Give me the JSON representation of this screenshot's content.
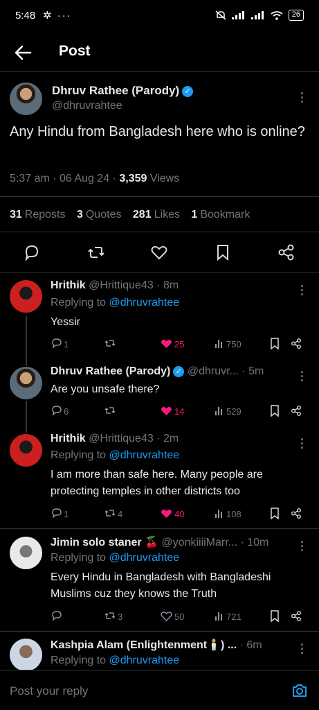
{
  "status_bar": {
    "time": "5:48",
    "left_icons": "✲ ···",
    "battery": "26"
  },
  "header": {
    "title": "Post"
  },
  "post": {
    "author_name": "Dhruv Rathee (Parody)",
    "author_handle": "@dhruvrahtee",
    "verified_mark": "✓",
    "text": "Any Hindu from Bangladesh here who is online?",
    "time_date": "5:37 am · 06 Aug 24 · ",
    "views_count": "3,359",
    "views_label": " Views",
    "reposts_count": "31",
    "reposts_label": "Reposts",
    "quotes_count": "3",
    "quotes_label": "Quotes",
    "likes_count": "281",
    "likes_label": "Likes",
    "bookmarks_count": "1",
    "bookmarks_label": "Bookmark"
  },
  "replies": [
    {
      "name": "Hrithik",
      "handle": "@Hrittique43",
      "time": "· 8m",
      "replying_prefix": "Replying to ",
      "replying_to": "@dhruvrahtee",
      "text": "Yessir",
      "reply_count": "1",
      "repost_count": "",
      "like_count": "25",
      "views": "750"
    },
    {
      "name": "Dhruv Rathee (Parody)",
      "handle": "@dhruvr...",
      "time": "· 5m",
      "text": "Are you unsafe there?",
      "reply_count": "6",
      "repost_count": "",
      "like_count": "14",
      "views": "529"
    },
    {
      "name": "Hrithik",
      "handle": "@Hrittique43",
      "time": "· 2m",
      "replying_prefix": "Replying to ",
      "replying_to": "@dhruvrahtee",
      "text": "I am more than safe here. Many people are protecting temples in other districts too",
      "reply_count": "1",
      "repost_count": "4",
      "like_count": "40",
      "views": "108"
    },
    {
      "name": "Jimin solo staner 🍒",
      "handle": "@yonkiiiiMarr...",
      "time": "· 10m",
      "replying_prefix": "Replying to ",
      "replying_to": "@dhruvrahtee",
      "text": "Every Hindu in Bangladesh with Bangladeshi Muslims cuz they knows the Truth",
      "reply_count": "",
      "repost_count": "3",
      "like_count": "50",
      "views": "721"
    },
    {
      "name": "Kashpia Alam (Enlightenment🕯️) ...",
      "time": "· 6m",
      "replying_prefix": "Replying to ",
      "replying_to": "@dhruvrahtee"
    }
  ],
  "reply_bar": {
    "placeholder": "Post your reply"
  },
  "colors": {
    "accent": "#1d9bf0",
    "like": "#f91880",
    "muted": "#71767b",
    "divider": "#2f3336"
  }
}
